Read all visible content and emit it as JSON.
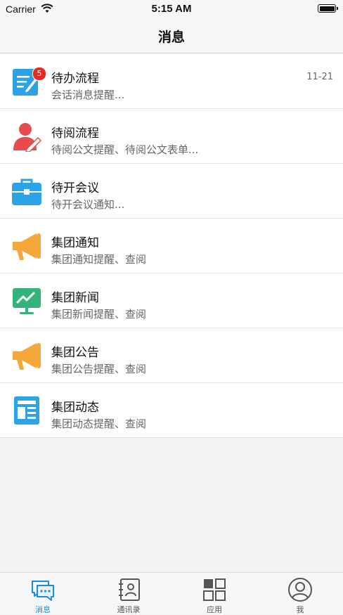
{
  "status_bar": {
    "carrier": "Carrier",
    "time": "5:15 AM"
  },
  "nav": {
    "title": "消息"
  },
  "colors": {
    "accent": "#1a8ce6",
    "badge": "#e62a22",
    "icon_blue": "#2ba3e6",
    "icon_red": "#e84b4b",
    "icon_orange": "#f5a83a",
    "icon_green": "#33b47a"
  },
  "messages": [
    {
      "title": "待办流程",
      "subtitle": "会话消息提醒...",
      "time": "11-21",
      "badge": "5",
      "icon": "edit-document-icon"
    },
    {
      "title": "待阅流程",
      "subtitle": "待阅公文提醒、待阅公文表单...",
      "time": "",
      "badge": "",
      "icon": "person-pen-icon"
    },
    {
      "title": "待开会议",
      "subtitle": "待开会议通知...",
      "time": "",
      "badge": "",
      "icon": "briefcase-icon"
    },
    {
      "title": "集团通知",
      "subtitle": "集团通知提醒、查阅",
      "time": "",
      "badge": "",
      "icon": "megaphone-icon"
    },
    {
      "title": "集团新闻",
      "subtitle": "集团新闻提醒、查阅",
      "time": "",
      "badge": "",
      "icon": "presentation-board-icon"
    },
    {
      "title": "集团公告",
      "subtitle": "集团公告提醒、查阅",
      "time": "",
      "badge": "",
      "icon": "megaphone-icon"
    },
    {
      "title": "集团动态",
      "subtitle": "集团动态提醒、查阅",
      "time": "",
      "badge": "",
      "icon": "newspaper-icon"
    }
  ],
  "tabs": [
    {
      "label": "消息",
      "icon": "chat-bubbles-icon",
      "active": true
    },
    {
      "label": "通讯录",
      "icon": "contacts-book-icon",
      "active": false
    },
    {
      "label": "应用",
      "icon": "apps-grid-icon",
      "active": false
    },
    {
      "label": "我",
      "icon": "profile-icon",
      "active": false
    }
  ]
}
